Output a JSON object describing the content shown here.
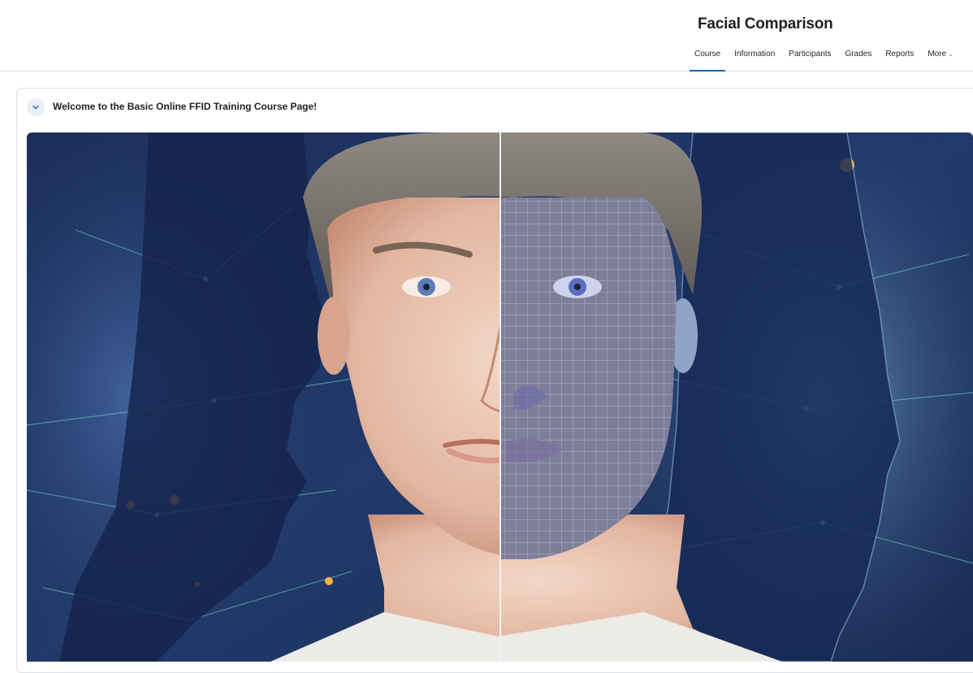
{
  "header": {
    "course_title": "Facial Comparison"
  },
  "nav": {
    "tabs": [
      {
        "label": "Course",
        "active": true
      },
      {
        "label": "Information",
        "active": false
      },
      {
        "label": "Participants",
        "active": false
      },
      {
        "label": "Grades",
        "active": false
      },
      {
        "label": "Reports",
        "active": false
      },
      {
        "label": "More",
        "active": false
      }
    ]
  },
  "section": {
    "title": "Welcome to the Basic Online FFID Training Course Page!",
    "toggle_icon": "chevron-down-icon",
    "banner_image": "facial-comparison-banner"
  },
  "colors": {
    "accent": "#0f6cbf",
    "toggle_bg": "#e7f0f9",
    "banner_dark_blue": "#13224a",
    "banner_light_blue": "#7fb3d8"
  }
}
